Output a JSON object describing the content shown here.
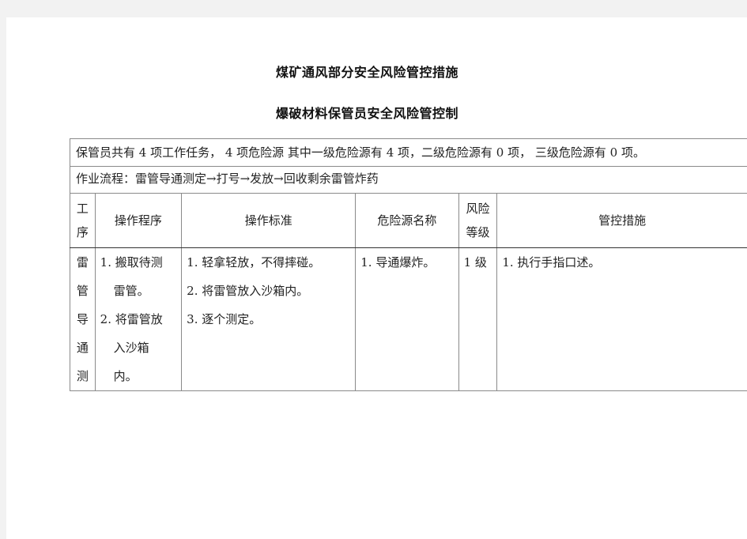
{
  "document": {
    "title": "煤矿通风部分安全风险管控措施",
    "subtitle": "爆破材料保管员安全风险管控制"
  },
  "table": {
    "summary": "保管员共有 4 项工作任务，  4 项危险源 其中一级危险源有 4 项，二级危险源有 0 项，  三级危险源有 0 项。",
    "workflow": "作业流程：雷管导通测定→打号→发放→回收剩余雷管炸药",
    "headers": {
      "process": [
        "工",
        "序"
      ],
      "steps": "操作程序",
      "standard": "操作标准",
      "hazard": "危险源名称",
      "level": [
        "风险",
        "等级"
      ],
      "control": "管控措施"
    },
    "rows": [
      {
        "process_chars": [
          "雷",
          "管",
          "导",
          "通",
          "测"
        ],
        "steps_lines": [
          "1. 搬取待测",
          "雷管。",
          "2. 将雷管放",
          "入沙箱",
          "内。"
        ],
        "standard_lines": [
          "1. 轻拿轻放，不得摔碰。",
          "2. 将雷管放入沙箱内。",
          "3. 逐个测定。"
        ],
        "hazard": "1. 导通爆炸。",
        "level": "1 级",
        "control": "1. 执行手指口述。"
      }
    ]
  }
}
